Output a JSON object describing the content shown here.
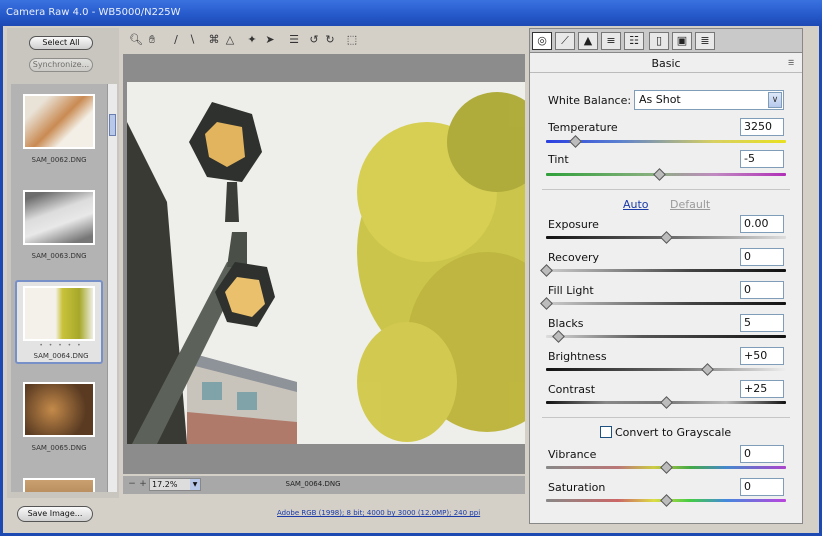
{
  "window": {
    "title": "Camera Raw 4.0",
    "subtitle": "WB5000/N225W"
  },
  "filmstrip": {
    "select_all": "Select All",
    "synchronize": "Synchronize...",
    "items": [
      {
        "name": "SAM_0062.DNG",
        "selected": false
      },
      {
        "name": "SAM_0063.DNG",
        "selected": false
      },
      {
        "name": "SAM_0064.DNG",
        "selected": true,
        "stars": "• • • • •"
      },
      {
        "name": "SAM_0065.DNG",
        "selected": false
      }
    ]
  },
  "toolbar": {
    "tools": [
      "zoom-icon",
      "hand-icon",
      "eyedropper-icon",
      "color-sampler-icon",
      "crop-icon",
      "straighten-icon",
      "spot-removal-icon",
      "red-eye-icon",
      "preferences-icon",
      "rotate-left-icon",
      "rotate-right-icon",
      "trash-icon"
    ]
  },
  "preview": {
    "zoom": "17.2%",
    "filename": "SAM_0064.DNG"
  },
  "bottom": {
    "save_image": "Save Image...",
    "workflow": "Adobe RGB (1998); 8 bit; 4000 by 3000 (12.0MP); 240 ppi"
  },
  "panel": {
    "title": "Basic",
    "tabs": [
      "basic-tab-icon",
      "tone-curve-tab-icon",
      "detail-tab-icon",
      "hsl-tab-icon",
      "split-toning-tab-icon",
      "lens-tab-icon",
      "camera-calibration-tab-icon",
      "presets-tab-icon"
    ],
    "white_balance": {
      "label": "White Balance:",
      "value": "As Shot"
    },
    "temperature": {
      "label": "Temperature",
      "value": "3250",
      "pos": 0.12
    },
    "tint": {
      "label": "Tint",
      "value": "-5",
      "pos": 0.47
    },
    "auto": "Auto",
    "default": "Default",
    "exposure": {
      "label": "Exposure",
      "value": "0.00",
      "pos": 0.5
    },
    "recovery": {
      "label": "Recovery",
      "value": "0",
      "pos": 0.0
    },
    "fill_light": {
      "label": "Fill Light",
      "value": "0",
      "pos": 0.0
    },
    "blacks": {
      "label": "Blacks",
      "value": "5",
      "pos": 0.05
    },
    "brightness": {
      "label": "Brightness",
      "value": "+50",
      "pos": 0.67
    },
    "contrast": {
      "label": "Contrast",
      "value": "+25",
      "pos": 0.5
    },
    "grayscale": "Convert to Grayscale",
    "vibrance": {
      "label": "Vibrance",
      "value": "0",
      "pos": 0.5
    },
    "saturation": {
      "label": "Saturation",
      "value": "0",
      "pos": 0.5
    }
  }
}
